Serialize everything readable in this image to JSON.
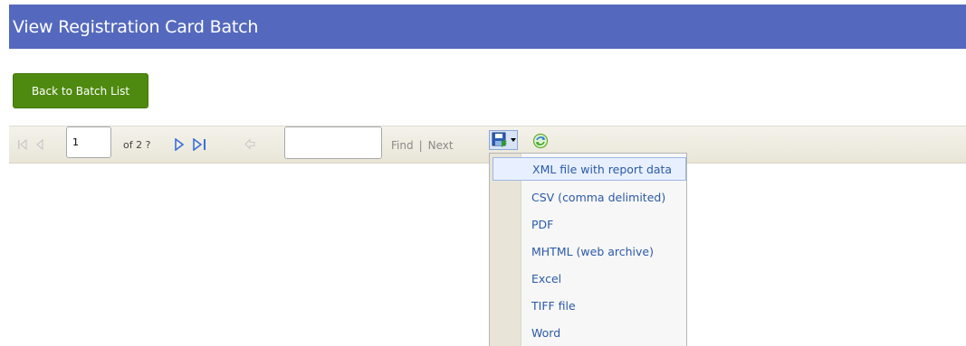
{
  "header": {
    "title": "View Registration Card Batch"
  },
  "actions": {
    "back_label": "Back to Batch List"
  },
  "toolbar": {
    "page_value": "1",
    "of_label": "of 2 ?",
    "find_label": "Find",
    "separator": "|",
    "next_label": "Next"
  },
  "export_menu": {
    "items": [
      {
        "label": "XML file with report data",
        "selected": true
      },
      {
        "label": "CSV (comma delimited)"
      },
      {
        "label": "PDF"
      },
      {
        "label": "MHTML (web archive)"
      },
      {
        "label": "Excel"
      },
      {
        "label": "TIFF file"
      },
      {
        "label": "Word"
      }
    ]
  },
  "colors": {
    "title_bar": "#5469be",
    "back_button": "#4f8a10",
    "menu_text": "#2b5aa8",
    "nav_active": "#3a6fd8"
  }
}
